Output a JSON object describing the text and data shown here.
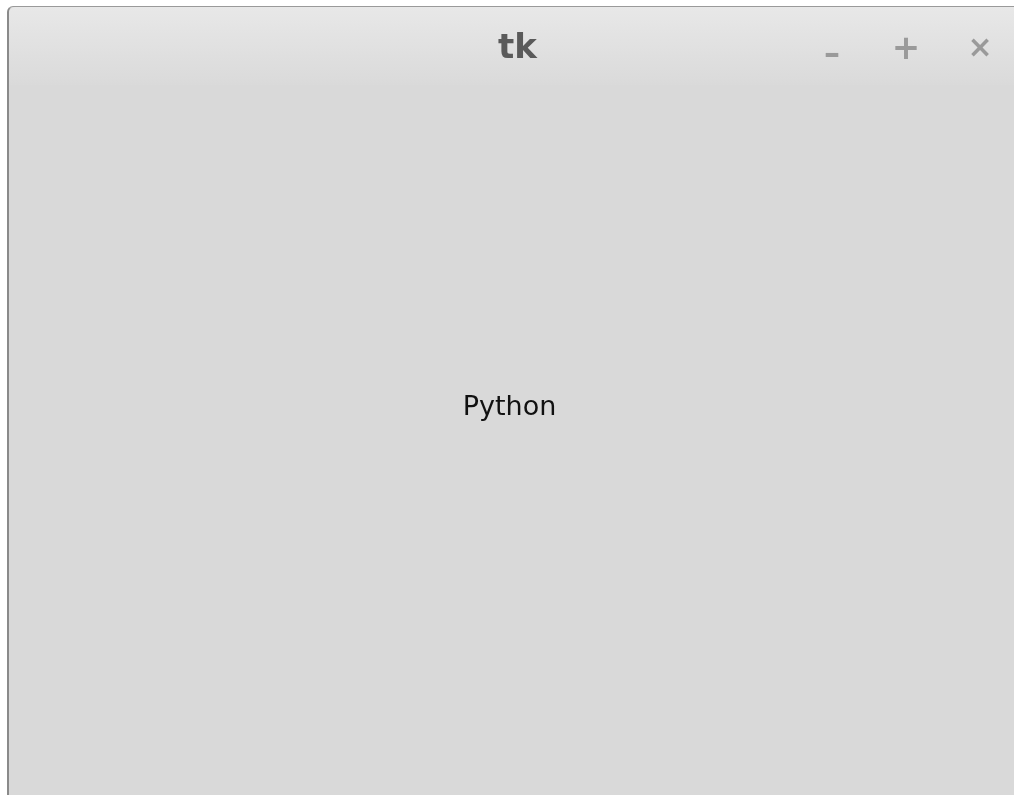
{
  "window": {
    "title": "tk",
    "controls": [
      {
        "kind": "minimize",
        "label": "–"
      },
      {
        "kind": "maximize",
        "label": "+"
      },
      {
        "kind": "close",
        "label": "×"
      }
    ]
  },
  "label": {
    "text": "Python"
  }
}
